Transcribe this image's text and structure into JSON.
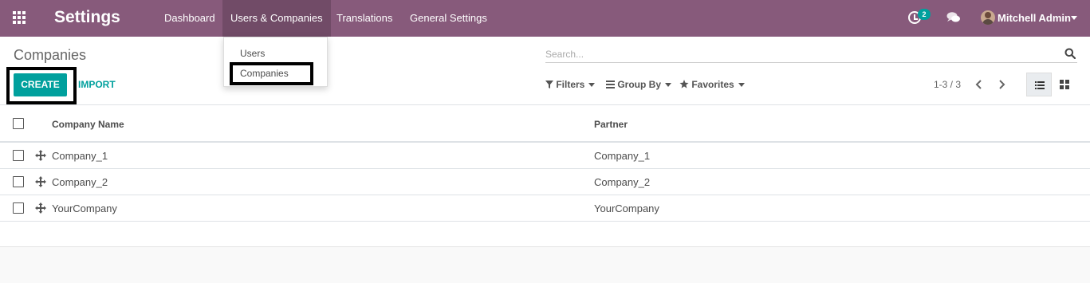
{
  "topbar": {
    "app_title": "Settings",
    "menu": [
      "Dashboard",
      "Users & Companies",
      "Translations",
      "General Settings"
    ],
    "activity_count": "2",
    "user_name": "Mitchell Admin"
  },
  "dropdown": {
    "items": [
      "Users",
      "Companies"
    ]
  },
  "control_panel": {
    "breadcrumb": "Companies",
    "search_placeholder": "Search...",
    "create_label": "CREATE",
    "import_label": "IMPORT",
    "filters_label": "Filters",
    "groupby_label": "Group By",
    "favorites_label": "Favorites",
    "pager": "1-3 / 3"
  },
  "table": {
    "columns": [
      "Company Name",
      "Partner"
    ],
    "rows": [
      {
        "company_name": "Company_1",
        "partner": "Company_1"
      },
      {
        "company_name": "Company_2",
        "partner": "Company_2"
      },
      {
        "company_name": "YourCompany",
        "partner": "YourCompany"
      }
    ]
  },
  "colors": {
    "brand": "#875a7b",
    "brand_active": "#714b67",
    "accent": "#00a09d"
  },
  "icons": [
    "apps-grid-icon",
    "activity-clock-icon",
    "chat-icon",
    "search-icon",
    "filter-icon",
    "group-by-icon",
    "star-icon",
    "chevron-left-icon",
    "chevron-right-icon",
    "list-view-icon",
    "kanban-view-icon",
    "drag-handle-icon"
  ]
}
